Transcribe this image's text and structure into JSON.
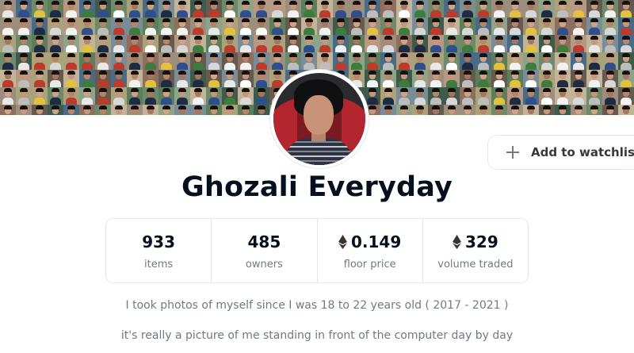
{
  "collection": {
    "title": "Ghozali Everyday",
    "watchlist_label": "Add to watchlist",
    "stats": [
      {
        "value": "933",
        "label": "items",
        "currency_icon": null
      },
      {
        "value": "485",
        "label": "owners",
        "currency_icon": null
      },
      {
        "value": "0.149",
        "label": "floor price",
        "currency_icon": "ethereum-icon"
      },
      {
        "value": "329",
        "label": "volume traded",
        "currency_icon": "ethereum-icon"
      }
    ],
    "description": [
      "I took photos of myself since I was 18 to 22 years old ( 2017 - 2021 )",
      "it's really a picture of me standing in front of the computer day by day"
    ]
  },
  "colors": {
    "text_primary": "#04111d",
    "text_secondary": "#707a83",
    "border": "#e5e8eb"
  }
}
